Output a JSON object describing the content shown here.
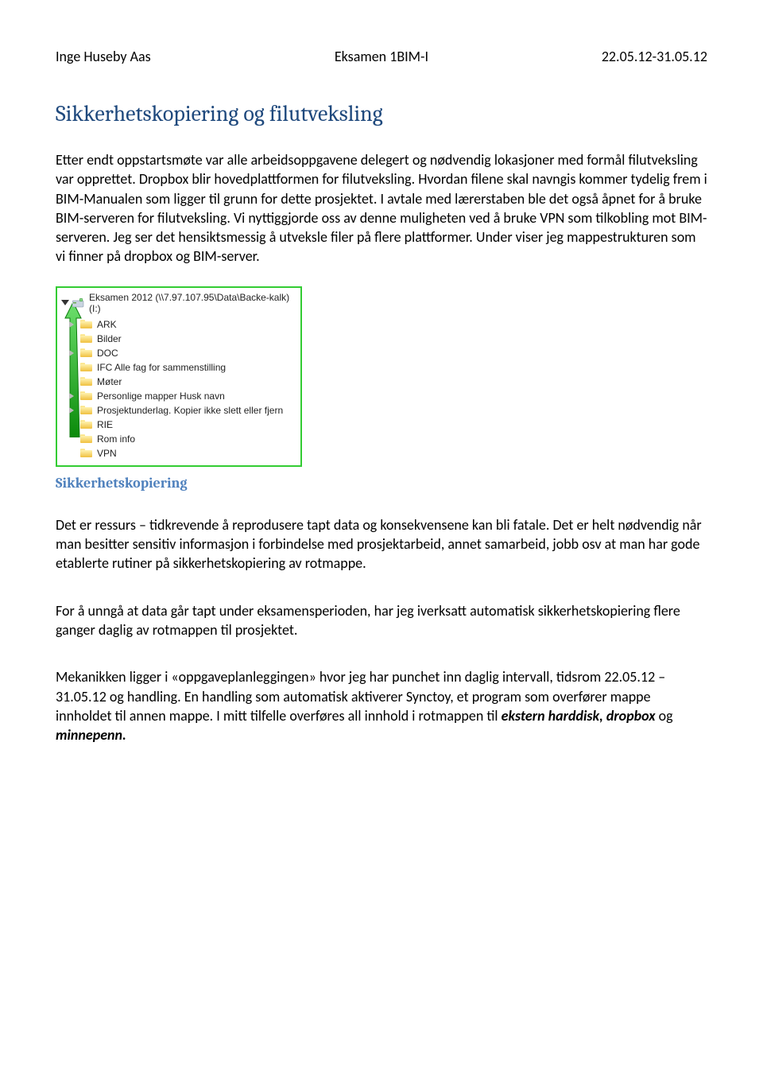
{
  "header": {
    "author": "Inge Huseby Aas",
    "title": "Eksamen 1BIM-I",
    "date": "22.05.12-31.05.12"
  },
  "section1": {
    "title": "Sikkerhetskopiering og filutveksling",
    "p1": "Etter endt oppstartsmøte var alle arbeidsoppgavene delegert og nødvendig lokasjoner med formål filutveksling var opprettet. Dropbox blir hovedplattformen for filutveksling. Hvordan filene skal navngis kommer tydelig frem i BIM-Manualen som ligger til grunn for dette prosjektet. I avtale med lærerstaben ble det også åpnet for å bruke BIM-serveren for filutveksling. Vi nyttiggjorde oss av denne muligheten ved å bruke VPN som tilkobling mot BIM-serveren. Jeg ser det hensiktsmessig å utveksle filer på flere plattformer. Under viser jeg mappestrukturen som vi finner på dropbox og BIM-server."
  },
  "tree": {
    "root": "Eksamen 2012 (\\\\7.97.107.95\\Data\\Backe-kalk) (I:)",
    "items": [
      "ARK",
      "Bilder",
      "DOC",
      "IFC Alle fag for sammenstilling",
      "Møter",
      "Personlige mapper Husk navn",
      "Prosjektunderlag. Kopier ikke slett eller fjern",
      "RIE",
      "Rom info",
      "VPN"
    ]
  },
  "section2": {
    "title": "Sikkerhetskopiering",
    "p1": "Det er ressurs – tidkrevende å reprodusere tapt data og konsekvensene kan bli fatale. Det er helt nødvendig når man besitter sensitiv informasjon i forbindelse med prosjektarbeid, annet samarbeid, jobb osv at man har gode etablerte rutiner på sikkerhetskopiering av rotmappe.",
    "p2": "For å unngå at data går tapt under eksamensperioden, har jeg iverksatt automatisk sikkerhetskopiering flere ganger daglig av rotmappen til prosjektet.",
    "p3a": "Mekanikken ligger i «oppgaveplanleggingen» hvor jeg har punchet inn daglig intervall, tidsrom 22.05.12 – 31.05.12 og handling. En handling som automatisk aktiverer Synctoy, et program som overfører mappe innholdet til annen mappe. I mitt tilfelle overføres all innhold i rotmappen til ",
    "p3b": "ekstern harddisk, dropbox",
    "p3c": " og ",
    "p3d": "minnepenn.",
    "p3e": ""
  }
}
